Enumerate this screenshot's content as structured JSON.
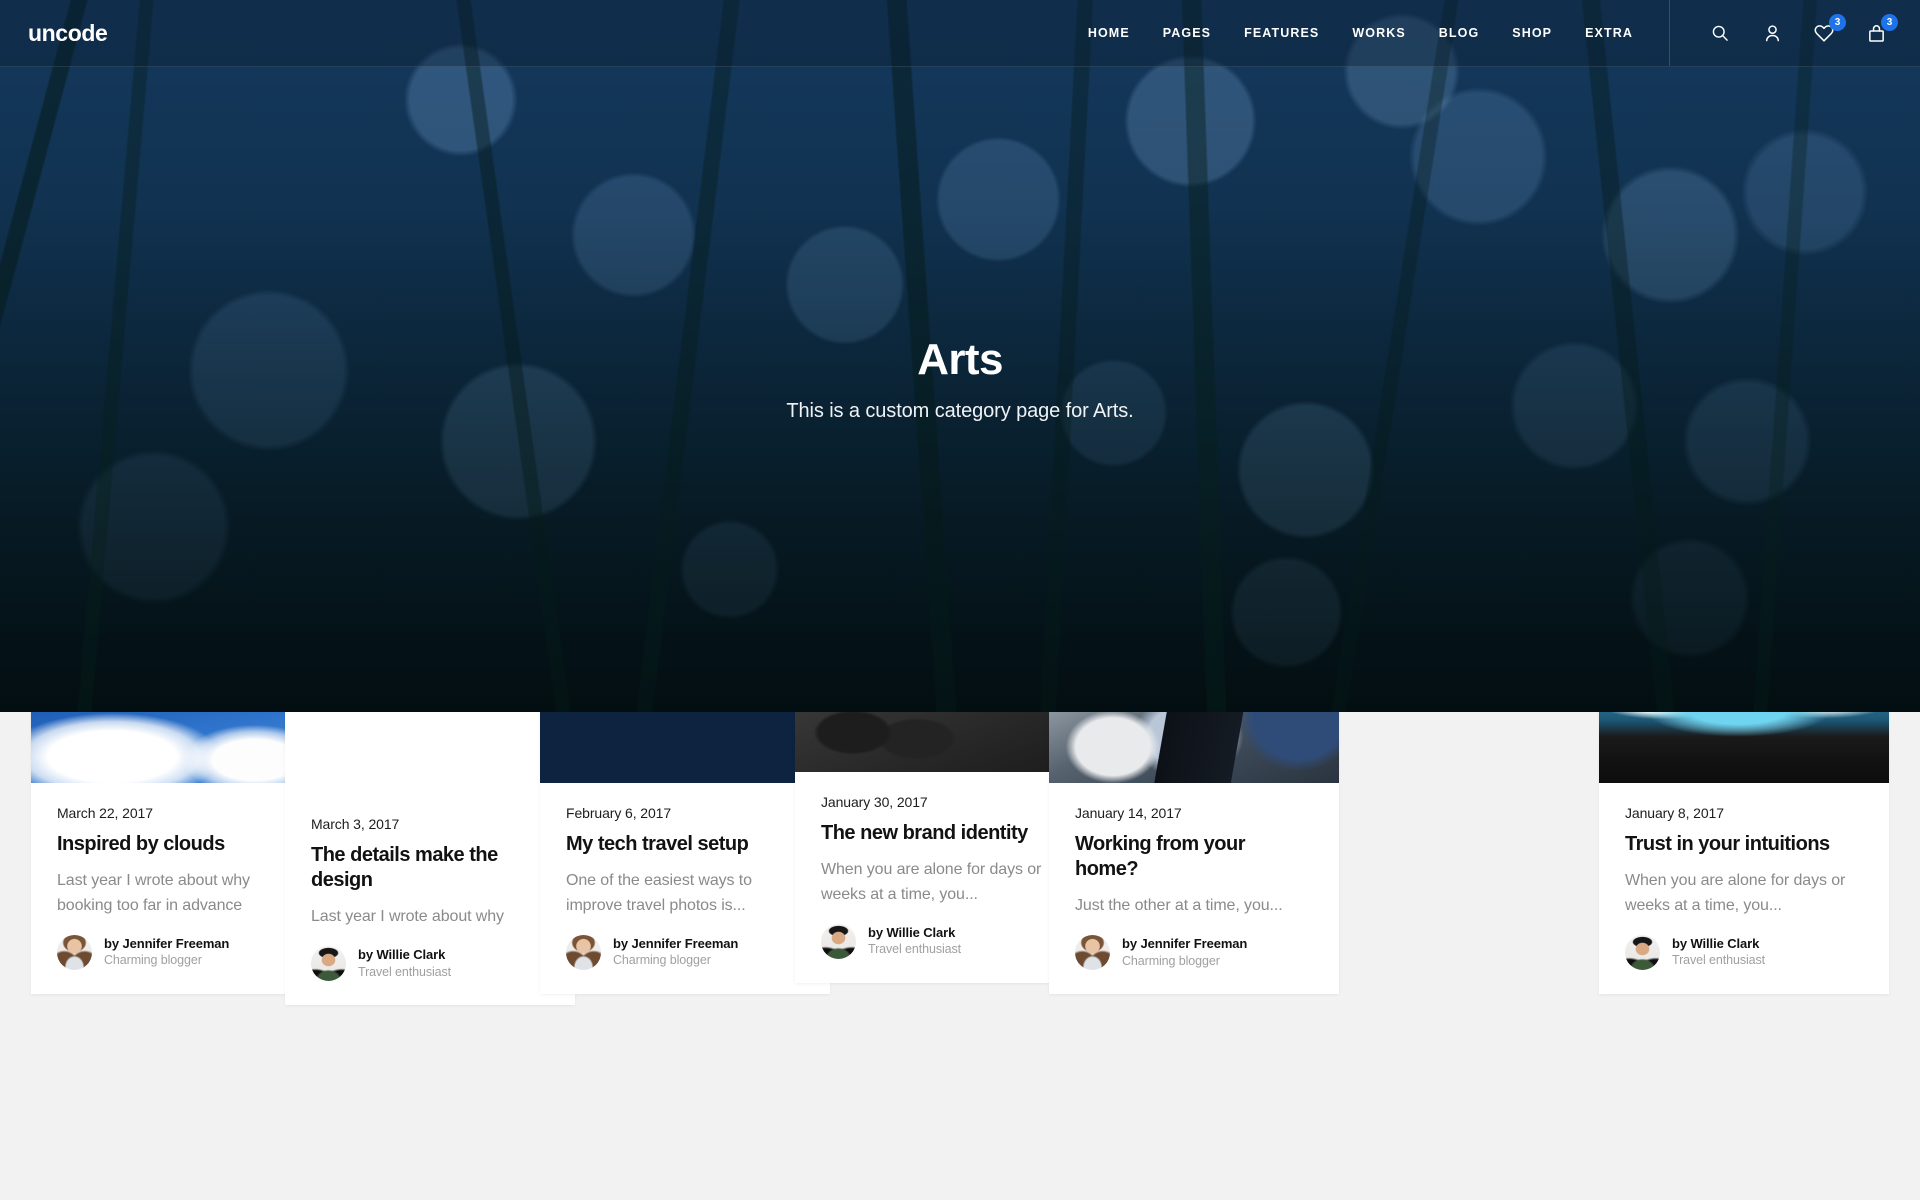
{
  "header": {
    "brand": "uncode",
    "menu": [
      {
        "label": "HOME"
      },
      {
        "label": "PAGES"
      },
      {
        "label": "FEATURES"
      },
      {
        "label": "WORKS"
      },
      {
        "label": "BLOG"
      },
      {
        "label": "SHOP"
      },
      {
        "label": "EXTRA"
      }
    ],
    "tools": [
      {
        "icon": "search-icon",
        "badge": ""
      },
      {
        "icon": "user-icon",
        "badge": ""
      },
      {
        "icon": "heart-icon",
        "badge": "3"
      },
      {
        "icon": "shopping-bag-icon",
        "badge": "3"
      }
    ],
    "accent_color": "#1e73e8"
  },
  "hero": {
    "title": "Arts",
    "subtitle": "This is a custom category page for Arts.",
    "background": "dark-blue-bokeh-grass-photo"
  },
  "posts": [
    {
      "date": "March 22, 2017",
      "title": "Inspired by clouds",
      "excerpt": "Last year I wrote about why booking too far in advance",
      "author_name": "by Jennifer Freeman",
      "author_role": "Charming blogger",
      "thumb": "sunlit-clouds-blue-sky",
      "avatar": "jennifer-freeman-portrait"
    },
    {
      "date": "March 3, 2017",
      "title": "The details make the design",
      "excerpt": "Last year I wrote about why",
      "author_name": "by Willie Clark",
      "author_role": "Travel enthusiast",
      "thumb": "black-road-bicycle",
      "avatar": "willie-clark-portrait"
    },
    {
      "date": "February 6, 2017",
      "title": "My tech travel setup",
      "excerpt": "One of the easiest ways to improve travel photos is...",
      "author_name": "by Jennifer Freeman",
      "author_role": "Charming blogger",
      "thumb": "smartwatch-on-wrist",
      "avatar": "jennifer-freeman-portrait"
    },
    {
      "date": "January 30, 2017",
      "title": "The new brand identity",
      "excerpt": "When you are alone for days or weeks at a time, you...",
      "author_name": "by Willie Clark",
      "author_role": "Travel enthusiast",
      "thumb": "black-business-cards",
      "avatar": "willie-clark-portrait"
    },
    {
      "date": "January 14, 2017",
      "title": "Working from your home?",
      "excerpt": "Just the other at a time, you...",
      "author_name": "by Jennifer Freeman",
      "author_role": "Charming blogger",
      "thumb": "person-with-laptop",
      "avatar": "jennifer-freeman-portrait"
    },
    {
      "date": "January 8, 2017",
      "title": "Trust in your intuitions",
      "excerpt": "When you are alone for days or weeks at a time, you...",
      "author_name": "by Willie Clark",
      "author_role": "Travel enthusiast",
      "thumb": "ocean-wave-black-beach",
      "avatar": "willie-clark-portrait"
    }
  ]
}
